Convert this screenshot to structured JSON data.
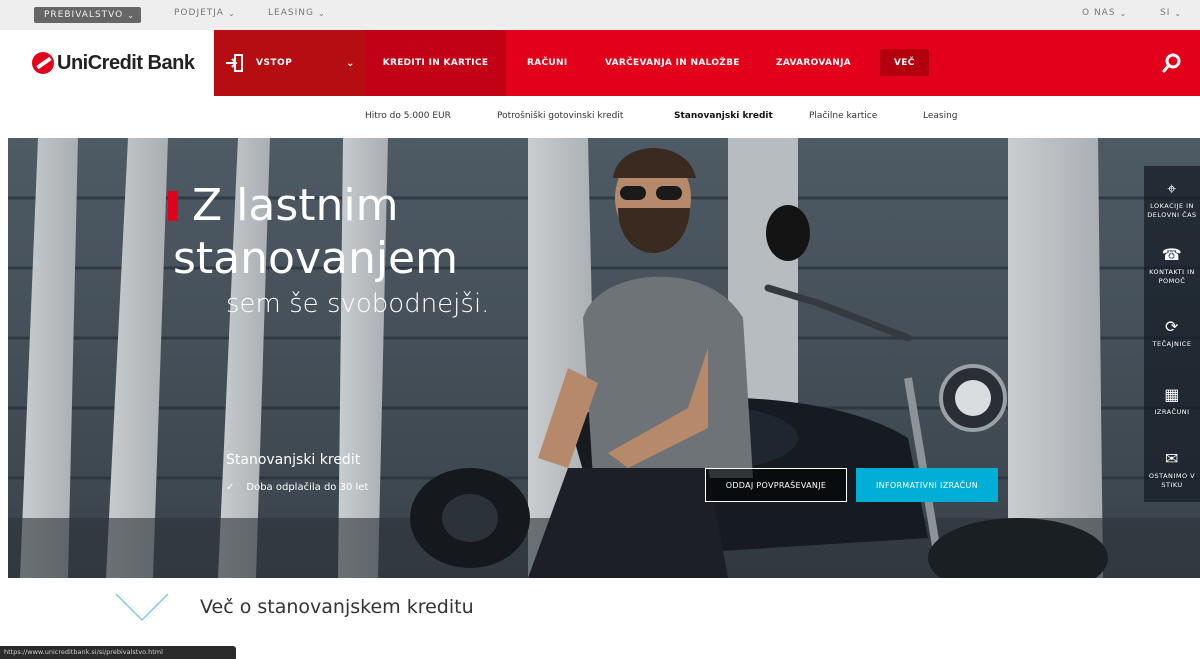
{
  "topbar": {
    "segment_active": "PREBIVALSTVO",
    "segment_companies": "PODJETJA",
    "segment_leasing": "LEASING",
    "about": "O NAS",
    "language": "SI"
  },
  "brand": {
    "logo_text": "UniCredit Bank"
  },
  "nav": {
    "login": "VSTOP",
    "items": [
      "KREDITI IN KARTICE",
      "RAČUNI",
      "VARČEVANJA IN NALOŽBE",
      "ZAVAROVANJA",
      "VEČ"
    ]
  },
  "subnav": {
    "items": [
      "Hitro do 5.000 EUR",
      "Potrošniški gotovinski kredit",
      "Stanovanjski kredit",
      "Plačilne kartice",
      "Leasing"
    ]
  },
  "hero": {
    "line1": "Z lastnim",
    "line2": "stanovanjem",
    "line3": "sem še svobodnejši.",
    "product_title": "Stanovanjski kredit",
    "feature": "Doba odplačila do 30 let",
    "btn_secondary": "ODDAJ POVPRAŠEVANJE",
    "btn_primary": "INFORMATIVNI IZRAČUN"
  },
  "sidebar": {
    "items": [
      {
        "icon": "location-pin-icon",
        "label1": "LOKACIJE IN",
        "label2": "DELOVNI ČAS"
      },
      {
        "icon": "contact-icon",
        "label1": "KONTAKTI IN",
        "label2": "POMOČ"
      },
      {
        "icon": "exchange-rates-icon",
        "label1": "TEČAJNICE",
        "label2": ""
      },
      {
        "icon": "calculator-icon",
        "label1": "IZRAČUNI",
        "label2": ""
      },
      {
        "icon": "mail-icon",
        "label1": "OSTANIMO V",
        "label2": "STIKU"
      }
    ]
  },
  "more": {
    "label": "Več o stanovanjskem kreditu"
  },
  "statusbar": {
    "url": "https://www.unicreditbank.si/si/prebivalstvo.html"
  },
  "colors": {
    "brand_red": "#e2001a",
    "dark_red": "#b50d12",
    "cta_blue": "#00aed6"
  }
}
